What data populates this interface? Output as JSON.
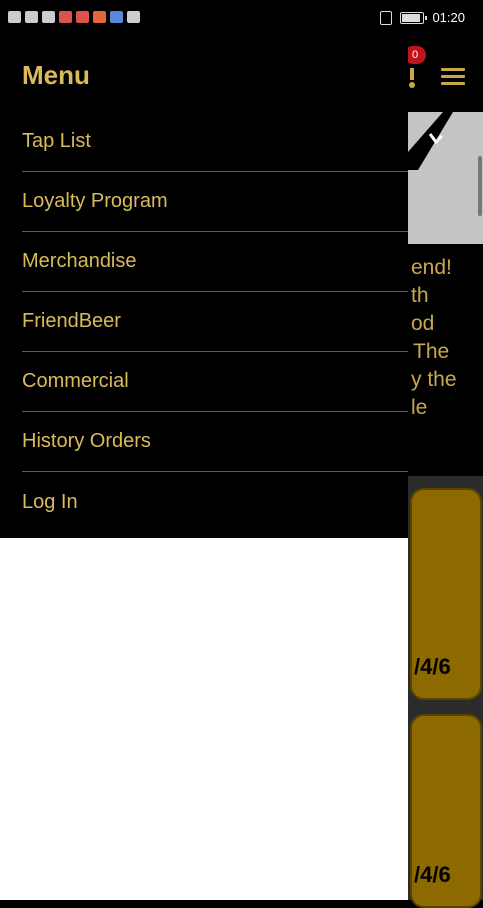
{
  "status_bar": {
    "time": "01:20"
  },
  "app_header": {
    "cart_badge": "0",
    "menu_icon": "hamburger-icon",
    "cart_icon": "cart-icon"
  },
  "promo": {
    "lines": [
      "end!",
      "th",
      "od",
      "The",
      "y the",
      "le"
    ]
  },
  "cards": [
    {
      "text": "/4/6"
    },
    {
      "text": "/4/6"
    }
  ],
  "drawer": {
    "title": "Menu",
    "items": [
      {
        "label": "Tap List"
      },
      {
        "label": "Loyalty Program"
      },
      {
        "label": "Merchandise"
      },
      {
        "label": "FriendBeer"
      },
      {
        "label": "Commercial"
      },
      {
        "label": "History Orders"
      },
      {
        "label": "Log In"
      }
    ]
  },
  "colors": {
    "accent": "#d9bb5a",
    "drawer_bg": "#000000",
    "card_bg": "#8c6a00",
    "badge": "#c0141a"
  }
}
